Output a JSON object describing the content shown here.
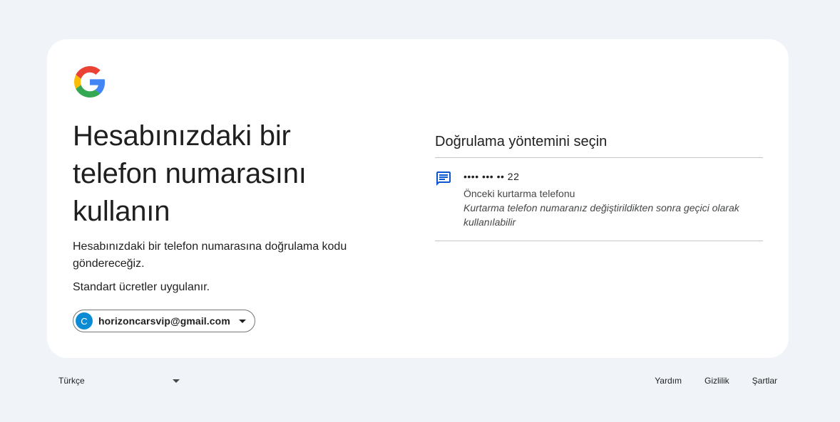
{
  "left": {
    "title": "Hesabınızdaki bir telefon numarasını kullanın",
    "description": "Hesabınızdaki bir telefon numarasına doğrulama kodu göndereceğiz.",
    "rates_note": "Standart ücretler uygulanır.",
    "account": {
      "avatar_letter": "C",
      "email": "horizoncarsvip@gmail.com"
    }
  },
  "right": {
    "section_title": "Doğrulama yöntemini seçin",
    "options": [
      {
        "phone": "•••• ••• •• 22",
        "label": "Önceki kurtarma telefonu",
        "note": "Kurtarma telefon numaranız değiştirildikten sonra geçici olarak kullanılabilir",
        "icon": "sms-icon"
      }
    ]
  },
  "footer": {
    "language": "Türkçe",
    "links": [
      "Yardım",
      "Gizlilik",
      "Şartlar"
    ]
  },
  "colors": {
    "background": "#f0f4f9",
    "card": "#ffffff",
    "avatar": "#0b8bd4",
    "accent": "#0b57d0"
  }
}
